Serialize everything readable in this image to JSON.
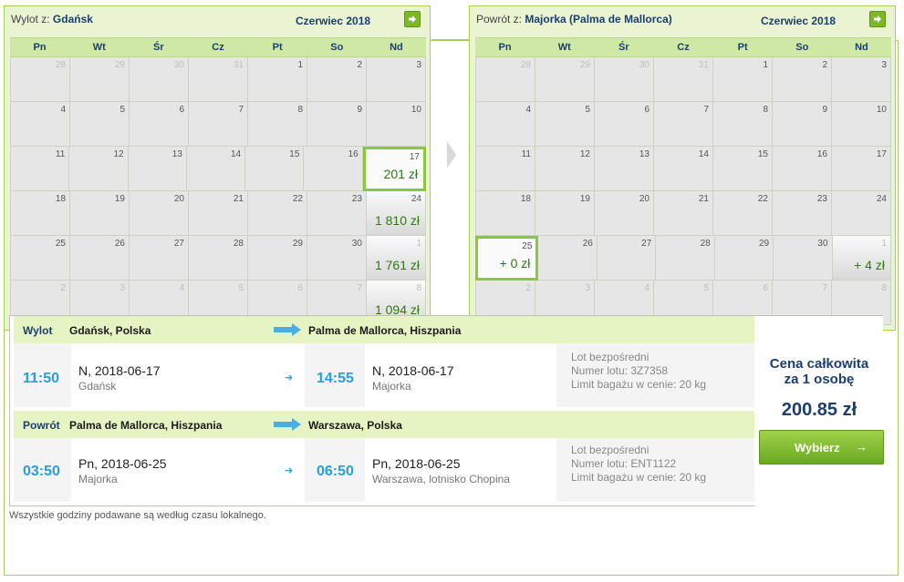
{
  "colors": {
    "accent_green": "#8cc63f",
    "price_green": "#2e7b10",
    "navy": "#1b3f6f",
    "time_blue": "#2a9ed8"
  },
  "outbound_calendar": {
    "route_prefix": "Wylot z:",
    "route_city": "Gdańsk",
    "month": "Czerwiec 2018",
    "next_icon": "arrow-right-icon",
    "days_of_week": [
      "Pn",
      "Wt",
      "Śr",
      "Cz",
      "Pt",
      "So",
      "Nd"
    ],
    "weeks": [
      [
        {
          "d": "28",
          "o": true
        },
        {
          "d": "29",
          "o": true
        },
        {
          "d": "30",
          "o": true
        },
        {
          "d": "31",
          "o": true
        },
        {
          "d": "1"
        },
        {
          "d": "2"
        },
        {
          "d": "3"
        }
      ],
      [
        {
          "d": "4"
        },
        {
          "d": "5"
        },
        {
          "d": "6"
        },
        {
          "d": "7"
        },
        {
          "d": "8"
        },
        {
          "d": "9"
        },
        {
          "d": "10"
        }
      ],
      [
        {
          "d": "11"
        },
        {
          "d": "12"
        },
        {
          "d": "13"
        },
        {
          "d": "14"
        },
        {
          "d": "15"
        },
        {
          "d": "16"
        },
        {
          "d": "17",
          "p": "201 zł",
          "s": true
        }
      ],
      [
        {
          "d": "18"
        },
        {
          "d": "19"
        },
        {
          "d": "20"
        },
        {
          "d": "21"
        },
        {
          "d": "22"
        },
        {
          "d": "23"
        },
        {
          "d": "24",
          "p": "1 810 zł"
        }
      ],
      [
        {
          "d": "25"
        },
        {
          "d": "26"
        },
        {
          "d": "27"
        },
        {
          "d": "28"
        },
        {
          "d": "29"
        },
        {
          "d": "30"
        },
        {
          "d": "1",
          "o": true,
          "p": "1 761 zł"
        }
      ],
      [
        {
          "d": "2",
          "o": true
        },
        {
          "d": "3",
          "o": true
        },
        {
          "d": "4",
          "o": true
        },
        {
          "d": "5",
          "o": true
        },
        {
          "d": "6",
          "o": true
        },
        {
          "d": "7",
          "o": true
        },
        {
          "d": "8",
          "o": true,
          "p": "1 094 zł"
        }
      ]
    ]
  },
  "return_calendar": {
    "route_prefix": "Powrót z:",
    "route_city": "Majorka (Palma de Mallorca)",
    "month": "Czerwiec 2018",
    "next_icon": "arrow-right-icon",
    "days_of_week": [
      "Pn",
      "Wt",
      "Śr",
      "Cz",
      "Pt",
      "So",
      "Nd"
    ],
    "weeks": [
      [
        {
          "d": "28",
          "o": true
        },
        {
          "d": "29",
          "o": true
        },
        {
          "d": "30",
          "o": true
        },
        {
          "d": "31",
          "o": true
        },
        {
          "d": "1"
        },
        {
          "d": "2"
        },
        {
          "d": "3"
        }
      ],
      [
        {
          "d": "4"
        },
        {
          "d": "5"
        },
        {
          "d": "6"
        },
        {
          "d": "7"
        },
        {
          "d": "8"
        },
        {
          "d": "9"
        },
        {
          "d": "10"
        }
      ],
      [
        {
          "d": "11"
        },
        {
          "d": "12"
        },
        {
          "d": "13"
        },
        {
          "d": "14"
        },
        {
          "d": "15"
        },
        {
          "d": "16"
        },
        {
          "d": "17"
        }
      ],
      [
        {
          "d": "18"
        },
        {
          "d": "19"
        },
        {
          "d": "20"
        },
        {
          "d": "21"
        },
        {
          "d": "22"
        },
        {
          "d": "23"
        },
        {
          "d": "24"
        }
      ],
      [
        {
          "d": "25",
          "p": "+ 0 zł",
          "s": true
        },
        {
          "d": "26"
        },
        {
          "d": "27"
        },
        {
          "d": "28"
        },
        {
          "d": "29"
        },
        {
          "d": "30"
        },
        {
          "d": "1",
          "o": true,
          "p": "+ 4 zł"
        }
      ],
      [
        {
          "d": "2",
          "o": true
        },
        {
          "d": "3",
          "o": true
        },
        {
          "d": "4",
          "o": true
        },
        {
          "d": "5",
          "o": true
        },
        {
          "d": "6",
          "o": true
        },
        {
          "d": "7",
          "o": true
        },
        {
          "d": "8",
          "o": true
        }
      ]
    ]
  },
  "outbound": {
    "label": "Wylot",
    "from": "Gdańsk, Polska",
    "to": "Palma de Mallorca, Hiszpania",
    "dep_time": "11:50",
    "dep_date": "N, 2018-06-17",
    "dep_city": "Gdańsk",
    "arr_time": "14:55",
    "arr_date": "N, 2018-06-17",
    "arr_city": "Majorka",
    "info1": "Lot bezpośredni",
    "info2": "Numer lotu: 3Z7358",
    "info3": "Limit bagażu w cenie: 20 kg"
  },
  "inbound": {
    "label": "Powrót",
    "from": "Palma de Mallorca, Hiszpania",
    "to": "Warszawa, Polska",
    "dep_time": "03:50",
    "dep_date": "Pn, 2018-06-25",
    "dep_city": "Majorka",
    "arr_time": "06:50",
    "arr_date": "Pn, 2018-06-25",
    "arr_city": "Warszawa, lotnisko Chopina",
    "info1": "Lot bezpośredni",
    "info2": "Numer lotu: ENT1122",
    "info3": "Limit bagażu w cenie: 20 kg"
  },
  "price": {
    "label_line1": "Cena całkowita",
    "label_line2": "za 1 osobę",
    "total": "200.85 zł",
    "button": "Wybierz",
    "button_arrow": "→"
  },
  "footer_note": "Wszystkie godziny podawane są według czasu lokalnego."
}
